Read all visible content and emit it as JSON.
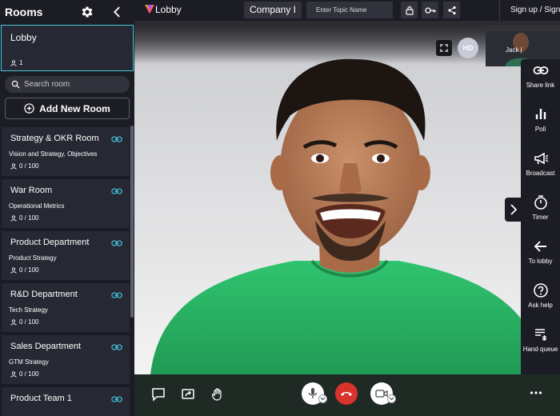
{
  "sidebar": {
    "title": "Rooms",
    "lobby": {
      "name": "Lobby",
      "count": "1"
    },
    "search_placeholder": "Search room",
    "add_room_label": "Add New Room",
    "rooms": [
      {
        "name": "Strategy & OKR Room",
        "subtitle": "Vision and Strategy, Objectives",
        "count": "0 / 100"
      },
      {
        "name": "War Room",
        "subtitle": "Operational Metrics",
        "count": "0 / 100"
      },
      {
        "name": "Product Department",
        "subtitle": "Product Strategy",
        "count": "0 / 100"
      },
      {
        "name": "R&D Department",
        "subtitle": "Tech Strategy",
        "count": "0 / 100"
      },
      {
        "name": "Sales Department",
        "subtitle": "GTM Strategy",
        "count": "0 / 100"
      },
      {
        "name": "Product Team 1",
        "subtitle": "",
        "count": ""
      }
    ]
  },
  "topbar": {
    "app_title": "Lobby",
    "company_label": "Company I",
    "topic_placeholder": "Enter Topic Name",
    "signup_label": "Sign up / Sign in"
  },
  "video": {
    "quality_badge": "HD",
    "thumbnail_name": "Jack |"
  },
  "right_panel": {
    "items": [
      {
        "label": "Share link",
        "icon": "link-icon"
      },
      {
        "label": "Poll",
        "icon": "poll-icon"
      },
      {
        "label": "Broadcast",
        "icon": "megaphone-icon"
      },
      {
        "label": "Timer",
        "icon": "timer-icon"
      },
      {
        "label": "To lobby",
        "icon": "arrow-left-icon"
      },
      {
        "label": "Ask help",
        "icon": "help-icon"
      },
      {
        "label": "Hand queue",
        "icon": "hand-queue-icon"
      }
    ]
  },
  "colors": {
    "accent": "#43c6d9",
    "hangup": "#d9342b",
    "background": "#1c1d24",
    "card": "#262833"
  }
}
